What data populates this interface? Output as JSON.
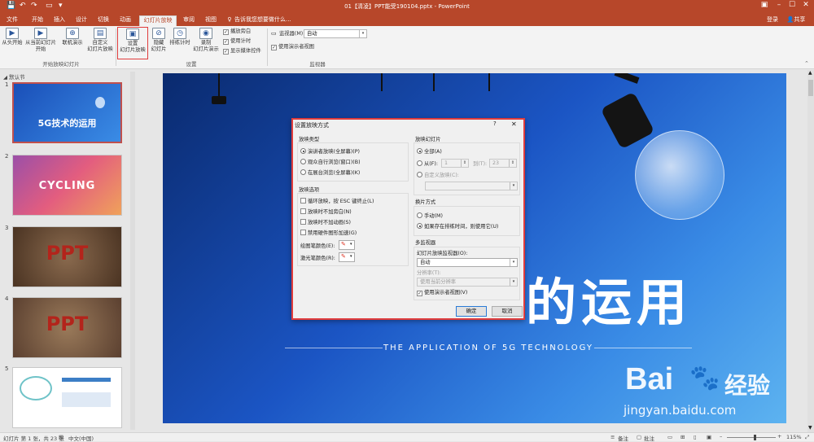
{
  "title_bar": {
    "title": "01【清凌】PPT能受190104.pptx - PowerPoint",
    "quick_access": [
      "save-icon",
      "undo-icon",
      "redo-icon",
      "start-from-beginning-icon",
      "customize-icon"
    ]
  },
  "tabs": [
    "文件",
    "开始",
    "插入",
    "设计",
    "切换",
    "动画",
    "幻灯片放映",
    "审阅",
    "视图"
  ],
  "tell_me": "告诉我您想要做什么...",
  "account": {
    "login": "登录",
    "share": "共享"
  },
  "ribbon": {
    "start_show": {
      "buttons": [
        "从头开始",
        "从当前幻灯片\n开始",
        "联机演示",
        "自定义\n幻灯片放映"
      ],
      "group_label": "开始放映幻灯片"
    },
    "setup": {
      "buttons": [
        "设置\n幻灯片放映",
        "隐藏\n幻灯片",
        "排练计时",
        "录制\n幻灯片演示"
      ],
      "checks": [
        {
          "label": "播放旁白",
          "checked": true
        },
        {
          "label": "使用计时",
          "checked": true
        },
        {
          "label": "显示媒体控件",
          "checked": true
        }
      ],
      "group_label": "设置"
    },
    "monitors": {
      "monitor_label": "监视器(M):",
      "monitor_value": "自动",
      "presenter_view": "使用演示者视图",
      "group_label": "监视器"
    }
  },
  "sections": {
    "default": "默认节"
  },
  "slides": [
    {
      "num": "1",
      "text": "5G技术的运用",
      "bg": "#2f6fd8"
    },
    {
      "num": "2",
      "text": "CYCLING",
      "bg": "#c74a8a"
    },
    {
      "num": "3",
      "text": "PPT",
      "bg": "#6b4b34"
    },
    {
      "num": "4",
      "text": "PPT",
      "bg": "#7a5a40"
    },
    {
      "num": "5",
      "text": "",
      "bg": "#ffffff"
    }
  ],
  "slide": {
    "title_fragment": "的运用",
    "subtitle": "THE APPLICATION OF 5G TECHNOLOGY",
    "watermark_brand": "Bai",
    "watermark_cn": "经验",
    "watermark_url": "jingyan.baidu.com"
  },
  "dialog": {
    "title": "设置放映方式",
    "help": "?",
    "close": "✕",
    "show_type": {
      "legend": "放映类型",
      "options": [
        {
          "label": "演讲者放映(全屏幕)(P)",
          "selected": true
        },
        {
          "label": "观众自行浏览(窗口)(B)",
          "selected": false
        },
        {
          "label": "在展台浏览(全屏幕)(K)",
          "selected": false
        }
      ]
    },
    "show_options": {
      "legend": "放映选项",
      "checks": [
        {
          "label": "循环放映，按 ESC 键终止(L)",
          "checked": false
        },
        {
          "label": "放映时不加旁白(N)",
          "checked": false
        },
        {
          "label": "放映时不加动画(S)",
          "checked": false
        },
        {
          "label": "禁用硬件图形加速(G)",
          "checked": false
        }
      ],
      "pen_color_label": "绘图笔颜色(E):",
      "laser_color_label": "激光笔颜色(R):"
    },
    "show_slides": {
      "legend": "放映幻灯片",
      "all": "全部(A)",
      "from": "从(F):",
      "from_value": "1",
      "to": "到(T):",
      "to_value": "23",
      "custom": "自定义放映(C):"
    },
    "advance": {
      "legend": "换片方式",
      "manual": "手动(M)",
      "timings": "如果存在排练时间，则使用它(U)"
    },
    "multi_monitor": {
      "legend": "多监视器",
      "monitor_label": "幻灯片放映监视器(O):",
      "monitor_value": "自动",
      "resolution_label": "分辨率(T):",
      "resolution_value": "使用当前分辨率",
      "presenter_view": "使用演示者视图(V)"
    },
    "ok": "确定",
    "cancel": "取消"
  },
  "status": {
    "slide_info": "幻灯片 第 1 张，共 23 张",
    "language": "中文(中国)",
    "notes": "备注",
    "comments": "批注",
    "zoom": "115%"
  },
  "colors": {
    "accent": "#b7472a",
    "highlight": "#e03c3c"
  }
}
